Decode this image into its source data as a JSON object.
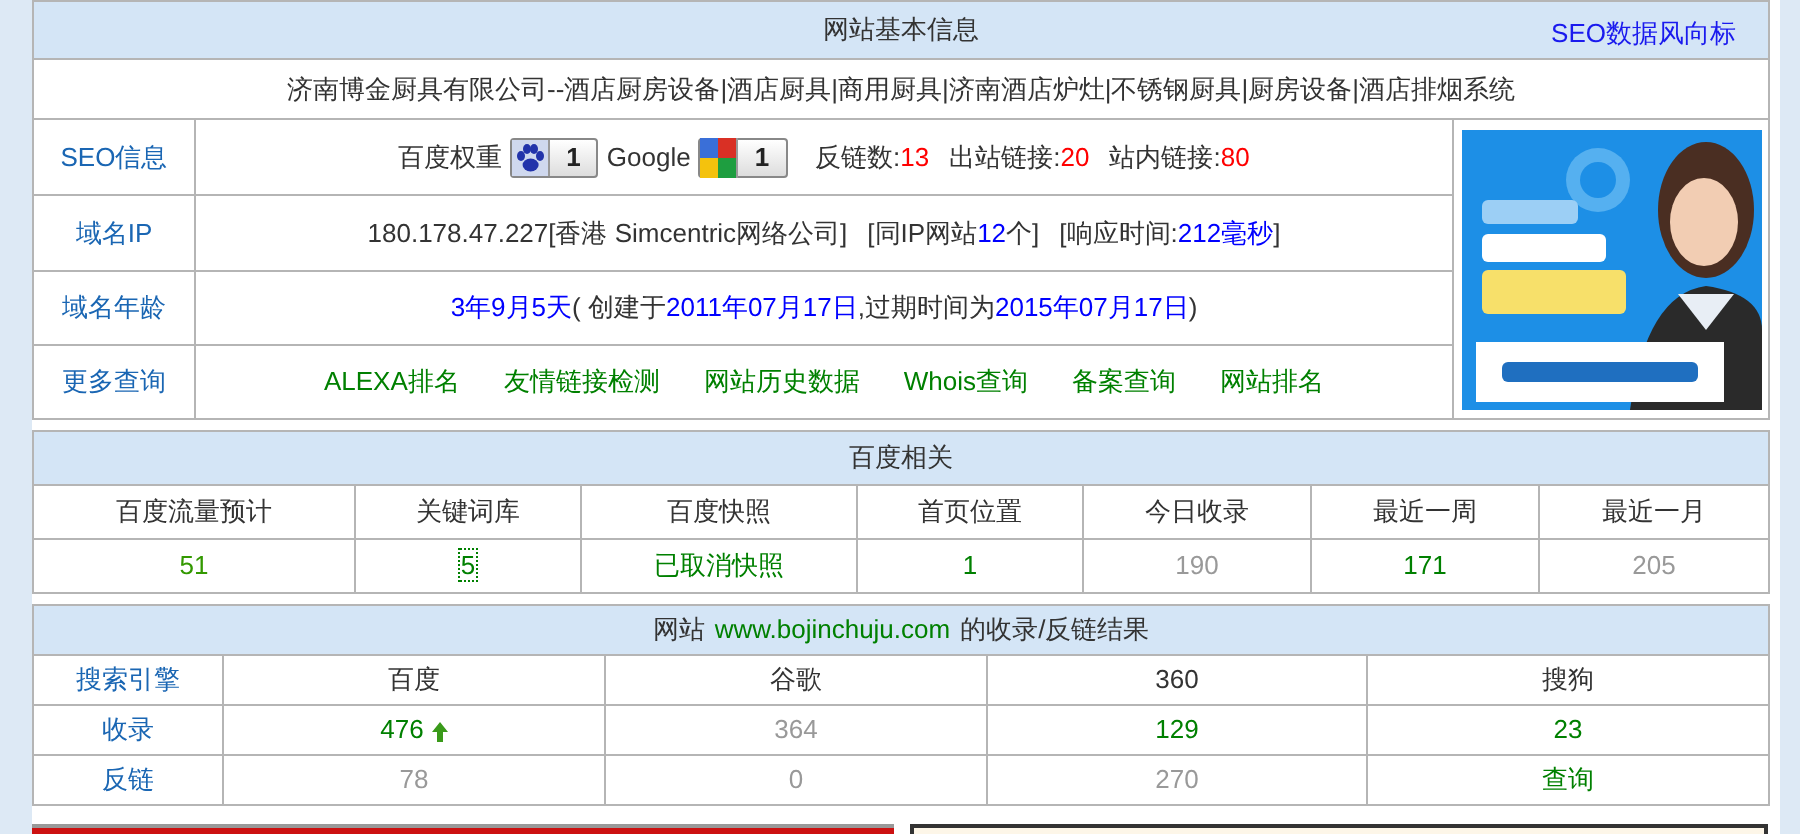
{
  "basic_info": {
    "title": "网站基本信息",
    "link": "SEO数据风向标",
    "site_title": "济南博金厨具有限公司--酒店厨房设备|酒店厨具|商用厨具|济南酒店炉灶|不锈钢厨具|厨房设备|酒店排烟系统",
    "rows": [
      {
        "label": "SEO信息",
        "segments": [
          {
            "kind": "text",
            "text": "百度权重"
          },
          {
            "kind": "pawbadge",
            "text": "1"
          },
          {
            "kind": "text",
            "text": "Google"
          },
          {
            "kind": "tilebadge",
            "text": "1"
          },
          {
            "kind": "gap"
          },
          {
            "kind": "text",
            "text": "反链数:"
          },
          {
            "kind": "text",
            "text": "13",
            "color": "#ff0000"
          },
          {
            "kind": "gap"
          },
          {
            "kind": "text",
            "text": "出站链接:"
          },
          {
            "kind": "text",
            "text": "20",
            "color": "#ff0000"
          },
          {
            "kind": "gap"
          },
          {
            "kind": "text",
            "text": "站内链接:"
          },
          {
            "kind": "text",
            "text": "80",
            "color": "#ff0000"
          }
        ]
      },
      {
        "label": "域名IP",
        "segments": [
          {
            "kind": "text",
            "text": "180.178.47.227[香港 Simcentric网络公司]"
          },
          {
            "kind": "gap"
          },
          {
            "kind": "text",
            "text": "[同IP网站"
          },
          {
            "kind": "text",
            "text": "12",
            "color": "#0000ff"
          },
          {
            "kind": "text",
            "text": "个]"
          },
          {
            "kind": "gap"
          },
          {
            "kind": "text",
            "text": "[响应时间: "
          },
          {
            "kind": "text",
            "text": "212毫秒",
            "color": "#0000ff"
          },
          {
            "kind": "text",
            "text": "]"
          }
        ]
      },
      {
        "label": "域名年龄",
        "segments": [
          {
            "kind": "text",
            "text": "3年9月5天",
            "color": "#0000ff"
          },
          {
            "kind": "text",
            "text": "( 创建于"
          },
          {
            "kind": "text",
            "text": "2011年07月17日",
            "color": "#0000ff"
          },
          {
            "kind": "text",
            "text": ",过期时间为"
          },
          {
            "kind": "text",
            "text": "2015年07月17日",
            "color": "#0000ff"
          },
          {
            "kind": "text",
            "text": ")"
          }
        ]
      },
      {
        "label": "更多查询",
        "segments": [
          {
            "kind": "link",
            "text": "ALEXA排名"
          },
          {
            "kind": "link",
            "text": "友情链接检测"
          },
          {
            "kind": "link",
            "text": "网站历史数据"
          },
          {
            "kind": "link",
            "text": "Whois查询"
          },
          {
            "kind": "link",
            "text": "备案查询"
          },
          {
            "kind": "link",
            "text": "网站排名"
          }
        ]
      }
    ]
  },
  "baidu_related": {
    "title": "百度相关",
    "columns": [
      {
        "label": "百度流量预计",
        "value": "51",
        "color": "#339900",
        "outlined": false
      },
      {
        "label": "关键词库",
        "value": "5",
        "color": "#008000",
        "outlined": true
      },
      {
        "label": "百度快照",
        "value": "已取消快照",
        "color": "#008000",
        "outlined": false
      },
      {
        "label": "首页位置",
        "value": "1",
        "color": "#008000",
        "outlined": false
      },
      {
        "label": "今日收录",
        "value": "190",
        "color": "#999999",
        "outlined": false
      },
      {
        "label": "最近一周",
        "value": "171",
        "color": "#008000",
        "outlined": false
      },
      {
        "label": "最近一月",
        "value": "205",
        "color": "#999999",
        "outlined": false
      }
    ]
  },
  "index_results": {
    "title_prefix": "网站",
    "domain": "www.bojinchuju.com",
    "title_suffix": "的收录/反链结果",
    "header_label": "搜索引擎",
    "columns": [
      "百度",
      "谷歌",
      "360",
      "搜狗"
    ],
    "rows": [
      {
        "label": "收录",
        "cells": [
          {
            "text": "476",
            "color": "#008000",
            "rising": true
          },
          {
            "text": "364",
            "color": "#999999",
            "rising": false
          },
          {
            "text": "129",
            "color": "#008000",
            "rising": false
          },
          {
            "text": "23",
            "color": "#008000",
            "rising": false
          }
        ]
      },
      {
        "label": "反链",
        "cells": [
          {
            "text": "78",
            "color": "#999999",
            "rising": false
          },
          {
            "text": "0",
            "color": "#999999",
            "rising": false
          },
          {
            "text": "270",
            "color": "#999999",
            "rising": false
          },
          {
            "text": "查询",
            "color": "#008000",
            "rising": false
          }
        ]
      }
    ]
  }
}
